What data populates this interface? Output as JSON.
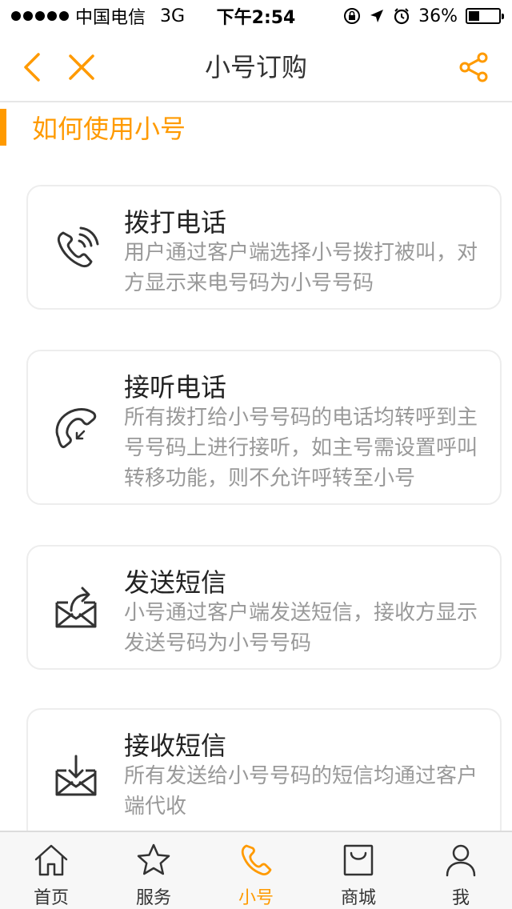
{
  "status_bar": {
    "carrier": "中国电信",
    "network": "3G",
    "time": "下午2:54",
    "battery": "36%",
    "battery_level": 0.36
  },
  "nav": {
    "title": "小号订购"
  },
  "section": {
    "title": "如何使用小号"
  },
  "cards": [
    {
      "title": "拨打电话",
      "desc": "用户通过客户端选择小号拨打被叫，对方显示来电号码为小号号码",
      "icon": "phone-call-icon"
    },
    {
      "title": "接听电话",
      "desc": "所有拨打给小号号码的电话均转呼到主号号码上进行接听，如主号需设置呼叫转移功能，则不允许呼转至小号",
      "icon": "phone-incoming-icon"
    },
    {
      "title": "发送短信",
      "desc": "小号通过客户端发送短信，接收方显示发送号码为小号号码",
      "icon": "mail-send-icon"
    },
    {
      "title": "接收短信",
      "desc": "所有发送给小号号码的短信均通过客户端代收",
      "icon": "mail-receive-icon"
    }
  ],
  "tabs": [
    {
      "label": "首页",
      "icon": "home-icon"
    },
    {
      "label": "服务",
      "icon": "star-icon"
    },
    {
      "label": "小号",
      "icon": "phone-icon"
    },
    {
      "label": "商城",
      "icon": "shopping-bag-icon"
    },
    {
      "label": "我",
      "icon": "user-icon"
    }
  ],
  "colors": {
    "accent": "#ff9a00",
    "icon_dark": "#333333",
    "text_secondary": "#999999"
  }
}
